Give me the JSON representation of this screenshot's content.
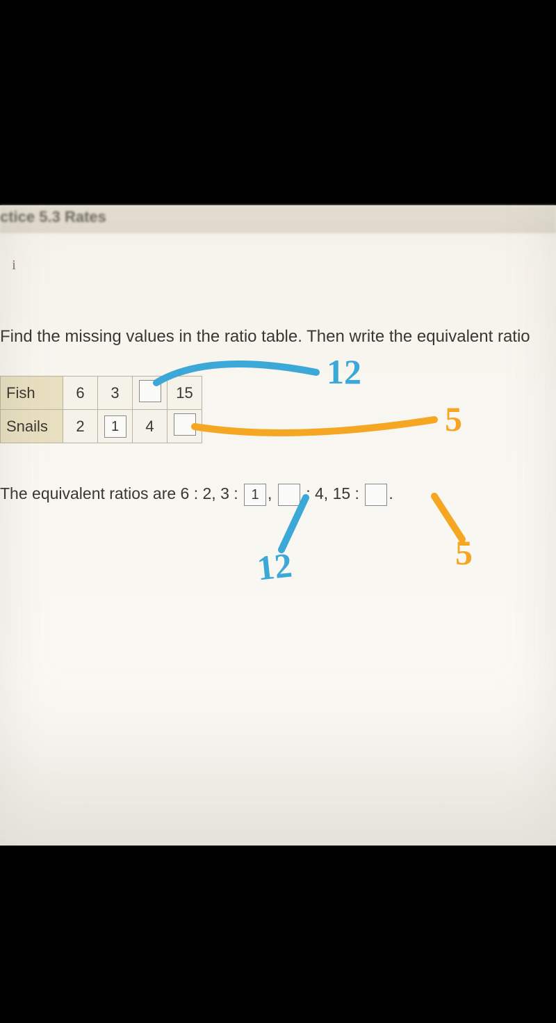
{
  "header": {
    "title": "ctice 5.3 Rates",
    "info_icon": "i"
  },
  "question": {
    "text": "Find the missing values in the ratio table. Then write the equivalent ratio"
  },
  "table": {
    "rows": [
      {
        "label": "Fish",
        "cells": [
          "6",
          "3",
          "",
          "15"
        ]
      },
      {
        "label": "Snails",
        "cells": [
          "2",
          "1",
          "4",
          ""
        ]
      }
    ],
    "input_values": {
      "r1_c1": "1"
    }
  },
  "answer": {
    "prefix": "The equivalent ratios are 6 : 2, 3 :",
    "box1": "1",
    "sep1": ",",
    "box2": "",
    "mid": ": 4, 15 :",
    "box3": "",
    "suffix": "."
  },
  "annotations": {
    "blue_12_top": "12",
    "orange_5_mid": "5",
    "blue_12_bottom": "12",
    "orange_5_bottom": "5"
  }
}
